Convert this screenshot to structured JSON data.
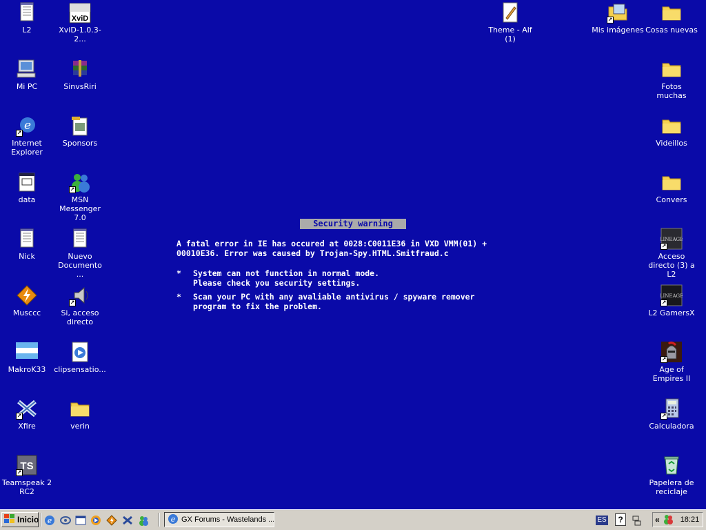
{
  "desktop": {
    "icons_left": [
      {
        "label": "L2",
        "icon": "notepad-document-icon"
      },
      {
        "label": "XviD-1.0.3-2...",
        "icon": "xvid-installer-icon"
      },
      {
        "label": "Mi PC",
        "icon": "my-computer-icon"
      },
      {
        "label": "SinvsRiri",
        "icon": "winrar-archive-icon"
      },
      {
        "label": "Internet Explorer",
        "icon": "internet-explorer-icon"
      },
      {
        "label": "Sponsors",
        "icon": "image-file-icon"
      },
      {
        "label": "data",
        "icon": "data-file-icon"
      },
      {
        "label": "MSN Messenger 7.0",
        "icon": "msn-messenger-icon"
      },
      {
        "label": "Nick",
        "icon": "notepad-document-icon"
      },
      {
        "label": "Nuevo Documento ...",
        "icon": "notepad-document-icon"
      },
      {
        "label": "Musccc",
        "icon": "winamp-icon"
      },
      {
        "label": "Si, acceso directo",
        "icon": "speaker-shortcut-icon"
      },
      {
        "label": "MakroK33",
        "icon": "flag-image-icon"
      },
      {
        "label": "clipsensatio...",
        "icon": "media-file-icon"
      },
      {
        "label": "Xfire",
        "icon": "xfire-icon"
      },
      {
        "label": "verin",
        "icon": "folder-icon"
      },
      {
        "label": "Teamspeak 2 RC2",
        "icon": "teamspeak-icon"
      }
    ],
    "icons_right": [
      {
        "label": "Theme - Alf (1)",
        "icon": "theme-file-icon"
      },
      {
        "label": "Mis imágenes",
        "icon": "my-pictures-icon"
      },
      {
        "label": "Cosas nuevas",
        "icon": "folder-icon"
      },
      {
        "label": "Fotos muchas",
        "icon": "folder-icon"
      },
      {
        "label": "Videillos",
        "icon": "folder-icon"
      },
      {
        "label": "Convers",
        "icon": "folder-icon"
      },
      {
        "label": "Acceso directo (3) a L2",
        "icon": "lineage-shortcut-icon"
      },
      {
        "label": "L2 GamersX",
        "icon": "lineage-shortcut-icon"
      },
      {
        "label": "Age of Empires II",
        "icon": "age-of-empires-icon"
      },
      {
        "label": "Calculadora",
        "icon": "calculator-icon"
      },
      {
        "label": "Papelera de reciclaje",
        "icon": "recycle-bin-icon"
      }
    ]
  },
  "warning": {
    "title": "Security warning",
    "line1": "A fatal error in IE has occured at 0028:C0011E36 in VXD VMM(01) +",
    "line2": "00010E36. Error was caused by Trojan-Spy.HTML.Smitfraud.c",
    "bullet": "*",
    "item1_line1": "System can not function in normal mode.",
    "item1_line2": "Please check you security settings.",
    "item2_line1": "Scan your PC with any avaliable antivirus / spyware remover",
    "item2_line2": "program to fix the problem."
  },
  "taskbar": {
    "start_label": "Inicio",
    "task_label": "GX Forums - Wastelands ...",
    "lang": "ES",
    "help": "?",
    "tray_expand": "«",
    "clock": "18:21"
  }
}
